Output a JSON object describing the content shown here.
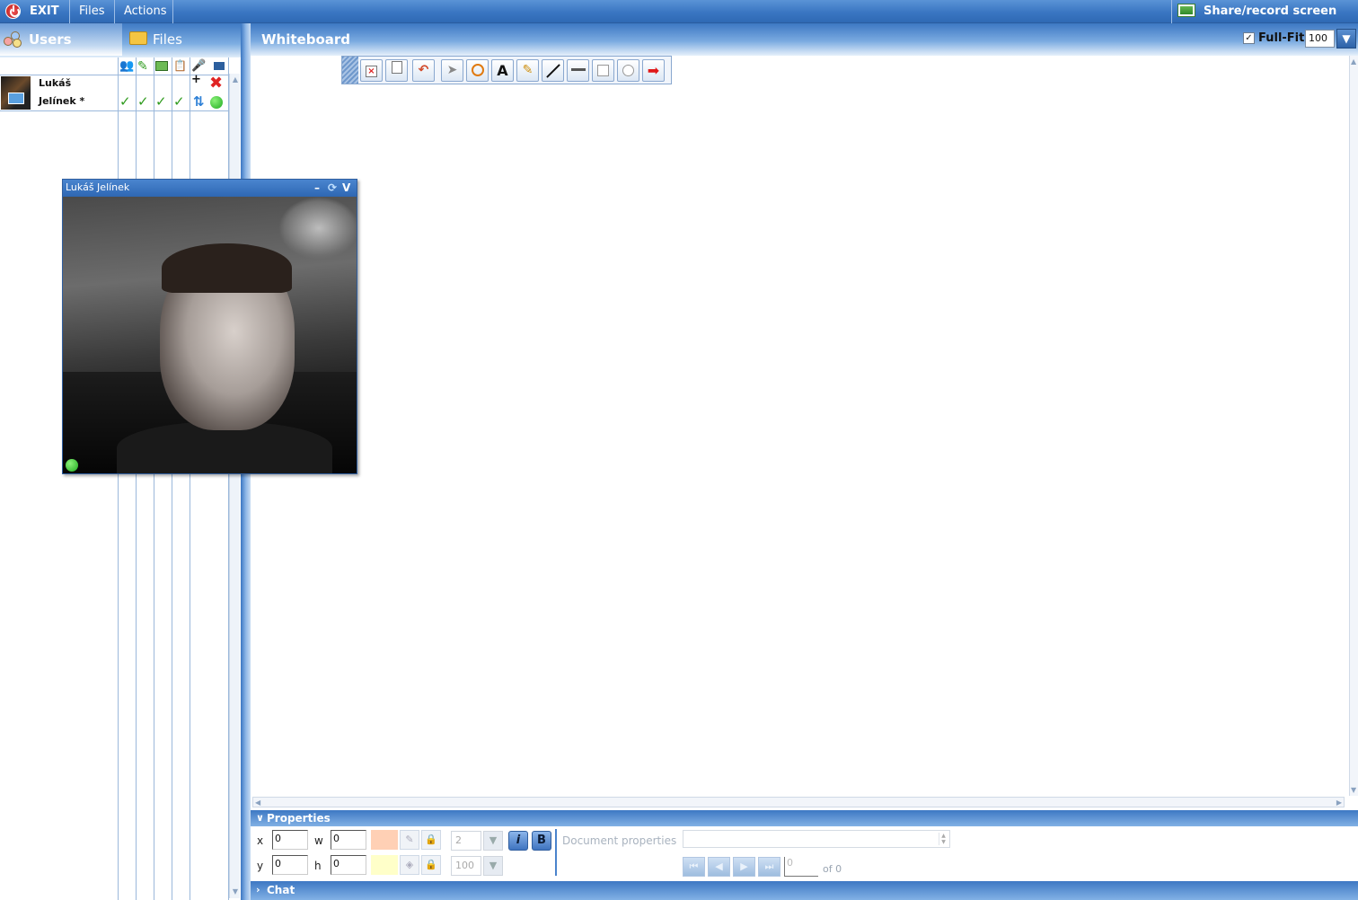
{
  "menubar": {
    "exit_label": "EXIT",
    "files_label": "Files",
    "actions_label": "Actions",
    "share_label": "Share/record screen"
  },
  "left_tabs": {
    "users_label": "Users",
    "files_label": "Files"
  },
  "users": [
    {
      "first_name": "Lukáš",
      "last_name": "Jelínek *"
    }
  ],
  "whiteboard": {
    "title": "Whiteboard",
    "fullfit_label": "Full-Fit",
    "fullfit_checked": true,
    "zoom_value": "100",
    "tools": [
      "clear-icon",
      "new-page-icon",
      "undo-icon",
      "pointer-icon",
      "pointer-circle-icon",
      "text-icon",
      "pencil-icon",
      "line-icon",
      "underline-icon",
      "rectangle-icon",
      "ellipse-icon",
      "arrow-icon"
    ]
  },
  "video_window": {
    "title": "Lukáš Jelínek",
    "minimize_label": "–",
    "sync_label": "⟳",
    "collapse_label": "V"
  },
  "properties": {
    "header": "Properties",
    "x_label": "x",
    "x_value": "0",
    "y_label": "y",
    "y_value": "0",
    "w_label": "w",
    "w_value": "0",
    "h_label": "h",
    "h_value": "0",
    "line_width": "2",
    "opacity": "100",
    "italic_label": "i",
    "bold_label": "B",
    "doc_props_label": "Document properties",
    "page_value": "0",
    "page_of": "of  0",
    "line_color": "#ffd0b5",
    "fill_color": "#ffffc9"
  },
  "chat": {
    "header": "Chat"
  },
  "colors": {
    "accent": "#3a76c2",
    "online": "#1faa1f",
    "check": "#2f9b1e",
    "remove": "#e02424"
  }
}
